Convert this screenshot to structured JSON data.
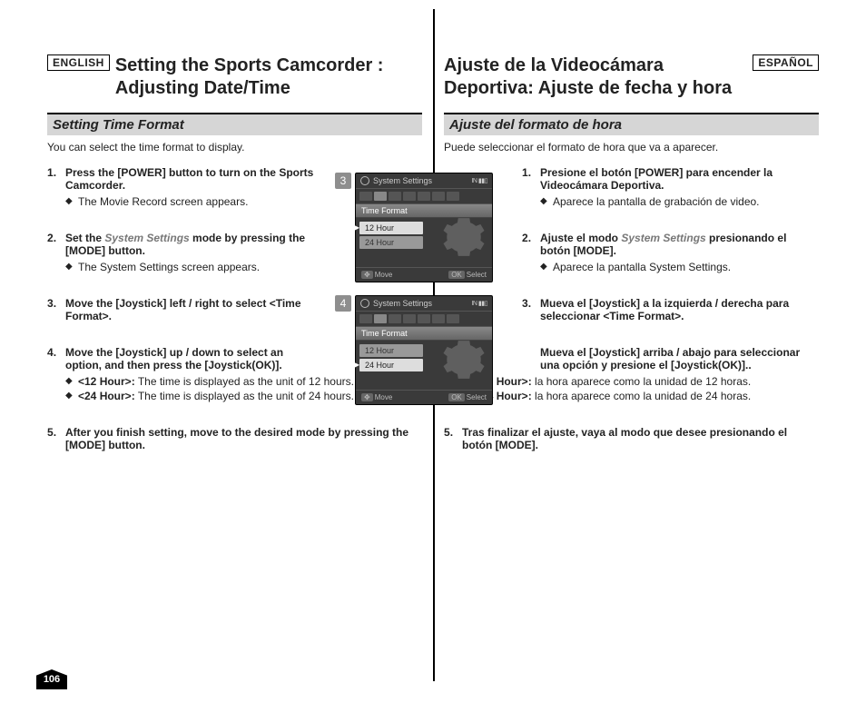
{
  "page_number": "106",
  "en": {
    "lang_badge": "ENGLISH",
    "title": "Setting the Sports Camcorder : Adjusting Date/Time",
    "subhead": "Setting Time Format",
    "intro": "You can select the time format to display.",
    "steps": {
      "s1": {
        "title": "Press the [POWER] button to turn on the Sports Camcorder.",
        "sub": [
          "The Movie Record screen appears."
        ]
      },
      "s2": {
        "title_pre": "Set the ",
        "title_em": "System Settings",
        "title_post": " mode by pressing the [MODE] button.",
        "sub": [
          "The System Settings screen appears."
        ]
      },
      "s3": {
        "title": "Move the [Joystick] left / right to select <Time Format>."
      },
      "s4": {
        "title": "Move the [Joystick] up / down to select an option, and then press the [Joystick(OK)].",
        "sub_rich": [
          {
            "b": "<12 Hour>:",
            "t": " The time is displayed as the unit of 12 hours."
          },
          {
            "b": "<24 Hour>:",
            "t": " The time is displayed as the unit of 24 hours."
          }
        ]
      },
      "s5": {
        "title": "After you finish setting, move to the desired mode by pressing the [MODE] button."
      }
    }
  },
  "es": {
    "lang_badge": "ESPAÑOL",
    "title": "Ajuste de la Videocámara Deportiva: Ajuste de fecha y hora",
    "subhead": "Ajuste del formato de hora",
    "intro": "Puede seleccionar el formato de hora que va a aparecer.",
    "steps": {
      "s1": {
        "title": "Presione el botón [POWER] para encender la Videocámara Deportiva.",
        "sub": [
          "Aparece la pantalla de grabación de video."
        ]
      },
      "s2": {
        "title_pre": "Ajuste el modo ",
        "title_em": "System Settings",
        "title_post": " presionando el botón [MODE].",
        "sub": [
          "Aparece la pantalla System Settings."
        ]
      },
      "s3": {
        "title": "Mueva el [Joystick] a la izquierda / derecha para seleccionar <Time Format>."
      },
      "s4": {
        "title": "Mueva el [Joystick] arriba / abajo para seleccionar una opción y presione el [Joystick(OK)]..",
        "sub_rich": [
          {
            "b": "<12 Hour>:",
            "t": " la hora aparece como la unidad de 12 horas."
          },
          {
            "b": "<24 Hour>:",
            "t": " la hora aparece como la unidad de 24 horas."
          }
        ]
      },
      "s5": {
        "title": "Tras finalizar el ajuste, vaya al modo que desee presionando el botón [MODE]."
      }
    }
  },
  "screenshots": {
    "common": {
      "header": "System Settings",
      "indicator": "IN ▮▮▯",
      "row_label": "Time Format",
      "opt1": "12 Hour",
      "opt2": "24 Hour",
      "footer_move": "Move",
      "footer_select": "Select",
      "move_chip": "✥",
      "ok_chip": "OK"
    },
    "shot3_num": "3",
    "shot4_num": "4"
  }
}
